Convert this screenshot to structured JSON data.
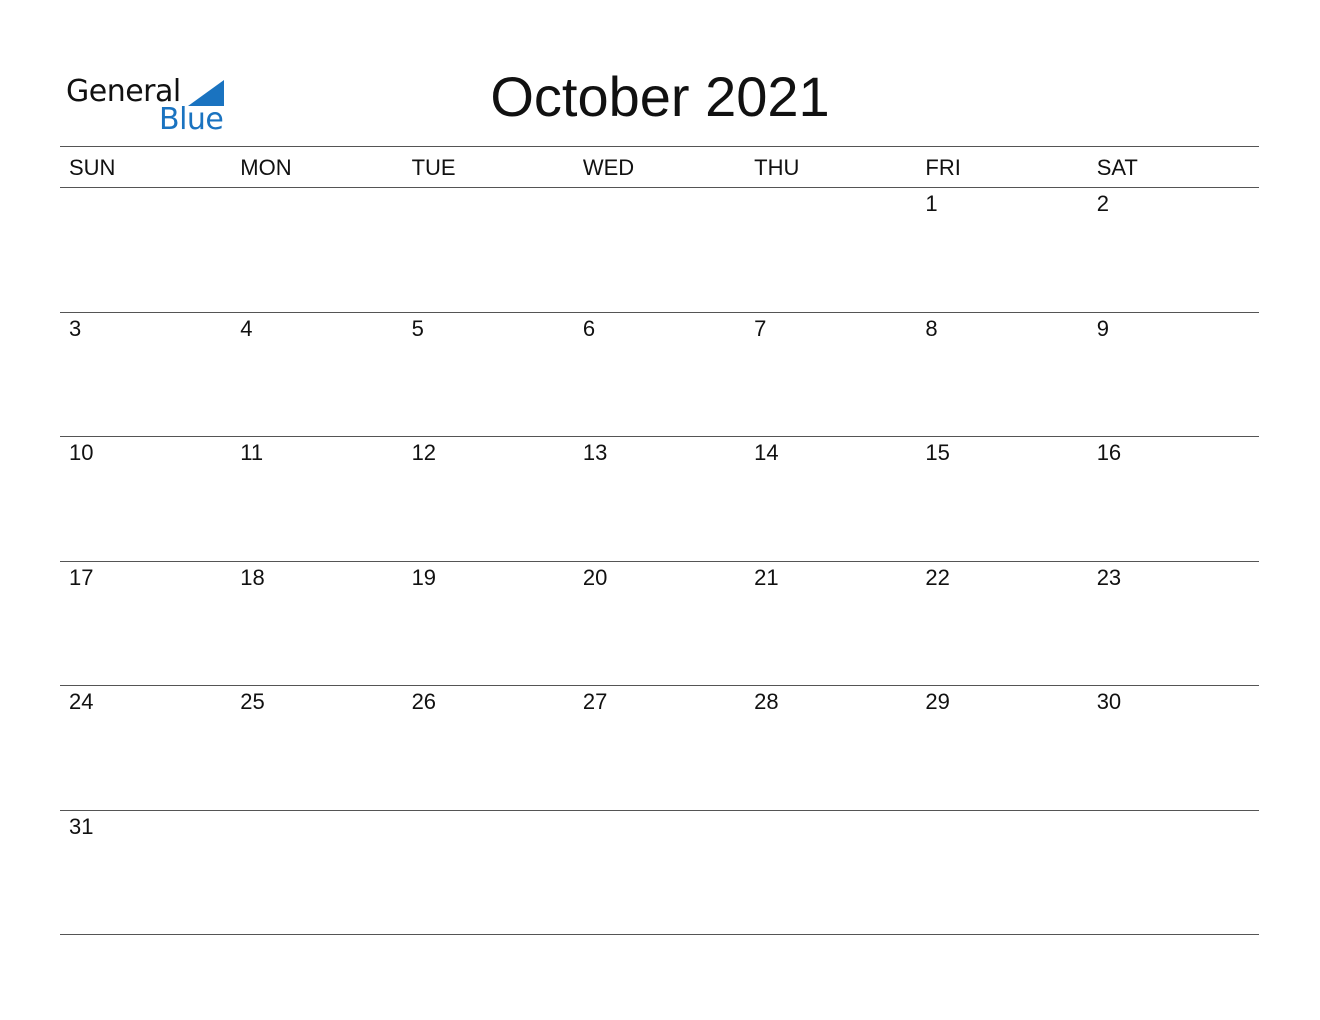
{
  "logo": {
    "line1": "General",
    "line2": "Blue",
    "accent": "#1a73c0"
  },
  "title": "October 2021",
  "weekdays": [
    "SUN",
    "MON",
    "TUE",
    "WED",
    "THU",
    "FRI",
    "SAT"
  ],
  "weeks": [
    [
      "",
      "",
      "",
      "",
      "",
      "1",
      "2"
    ],
    [
      "3",
      "4",
      "5",
      "6",
      "7",
      "8",
      "9"
    ],
    [
      "10",
      "11",
      "12",
      "13",
      "14",
      "15",
      "16"
    ],
    [
      "17",
      "18",
      "19",
      "20",
      "21",
      "22",
      "23"
    ],
    [
      "24",
      "25",
      "26",
      "27",
      "28",
      "29",
      "30"
    ],
    [
      "31",
      "",
      "",
      "",
      "",
      "",
      ""
    ]
  ]
}
